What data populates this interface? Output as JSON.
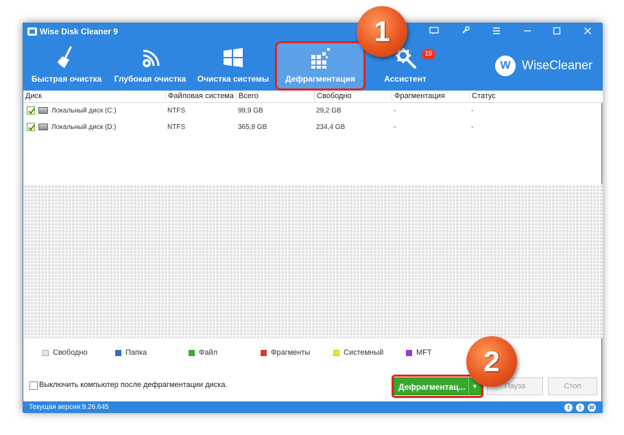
{
  "window": {
    "title": "Wise Disk Cleaner 9"
  },
  "nav": [
    {
      "label": "Быстрая очистка",
      "icon": "broom-icon"
    },
    {
      "label": "Глубокая очистка",
      "icon": "deep-clean-icon"
    },
    {
      "label": "Очистка системы",
      "icon": "windows-icon"
    },
    {
      "label": "Дефрагментация",
      "icon": "defrag-icon"
    },
    {
      "label": "Ассистент",
      "icon": "tools-icon",
      "badge": "19"
    }
  ],
  "brand": {
    "logo_letter": "W",
    "name": "WiseCleaner"
  },
  "table": {
    "headers": [
      "Диск",
      "Файловая система",
      "Всего",
      "Свободно",
      "Фрагментация",
      "Статус"
    ],
    "rows": [
      {
        "name": "Локальный диск (C:)",
        "fs": "NTFS",
        "total": "99,9 GB",
        "free": "29,2 GB",
        "frag": "-",
        "status": "-"
      },
      {
        "name": "Локальный диск (D:)",
        "fs": "NTFS",
        "total": "365,8 GB",
        "free": "234,4 GB",
        "frag": "-",
        "status": "-"
      }
    ]
  },
  "legend": [
    {
      "label": "Свободно",
      "color": "#e8e8e8"
    },
    {
      "label": "Папка",
      "color": "#2f6fc4"
    },
    {
      "label": "Файл",
      "color": "#3aa832"
    },
    {
      "label": "Фрагменты",
      "color": "#d23b30"
    },
    {
      "label": "Системный",
      "color": "#f0e23a"
    },
    {
      "label": "MFT",
      "color": "#9b3ad2"
    }
  ],
  "options": {
    "shutdown_label": "Выключить компьютер после дефрагментации диска."
  },
  "buttons": {
    "defrag": "Дефрагментац...",
    "pause": "Пауза",
    "stop": "Стоп"
  },
  "status": {
    "version": "Текущая версия:9.26.645"
  },
  "markers": [
    "1",
    "2"
  ],
  "colors": {
    "accent": "#2f86e0",
    "highlight": "#e0241e",
    "primary_button": "#36a82a"
  }
}
